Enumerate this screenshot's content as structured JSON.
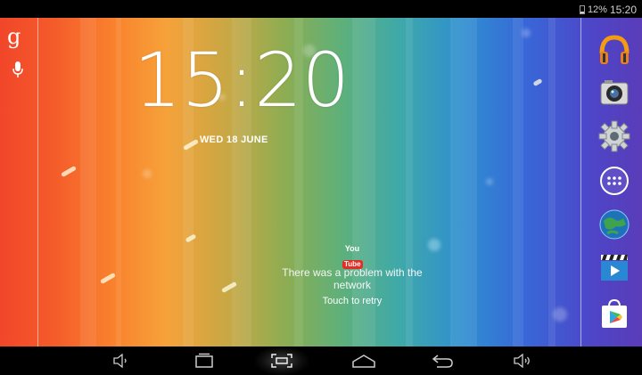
{
  "status_bar": {
    "battery_percent": "12%",
    "time": "15:20"
  },
  "left_bar": {
    "search_glyph": "g"
  },
  "lockscreen": {
    "clock": "15:20",
    "date": "WED 18 JUNE"
  },
  "youtube_widget": {
    "logo_you": "You",
    "logo_tube": "Tube",
    "error_message": "There was a problem with the network",
    "retry_label": "Touch to retry"
  },
  "dock": {
    "apps": [
      "play-music-icon",
      "camera-icon",
      "settings-icon",
      "app-drawer-icon",
      "browser-globe-icon",
      "video-player-icon",
      "play-store-icon"
    ]
  },
  "nav_bar": {
    "buttons": [
      "volume-down-icon",
      "recent-apps-icon",
      "screenshot-icon",
      "home-icon",
      "back-icon",
      "volume-up-icon"
    ],
    "active": "screenshot-icon"
  },
  "colors": {
    "youtube_red": "#e52d27",
    "battery_low": "#cfcfcf"
  }
}
